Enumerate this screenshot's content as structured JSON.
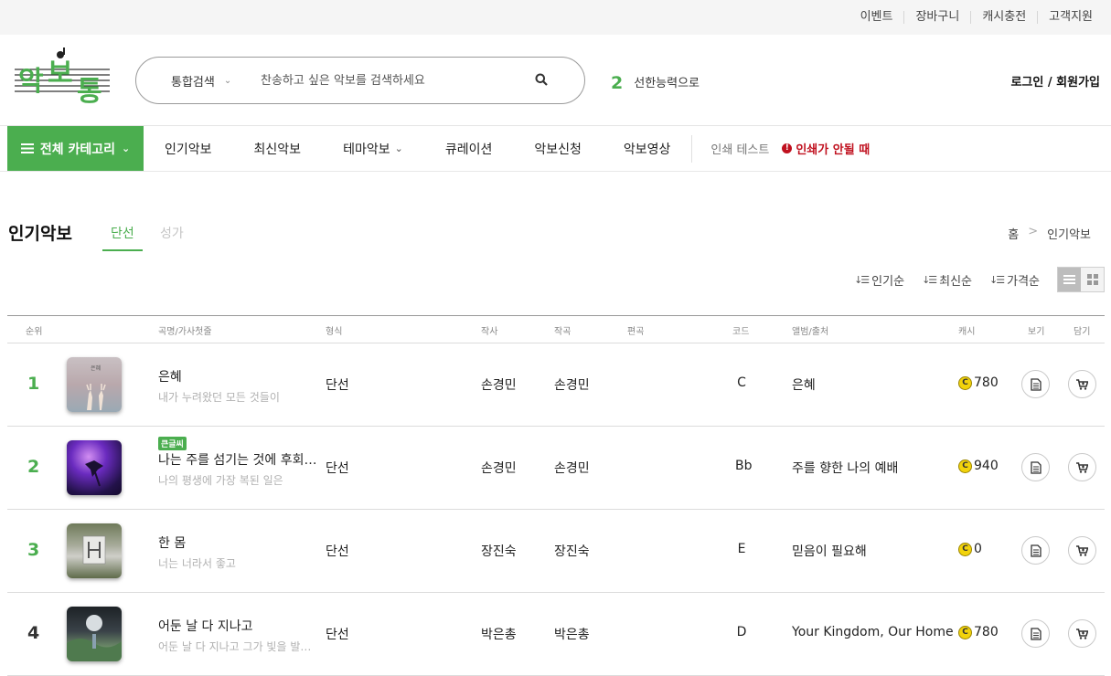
{
  "topbar": {
    "links": [
      "이벤트",
      "장바구니",
      "캐시충전",
      "고객지원"
    ]
  },
  "brand": {
    "logo_text": "악보통",
    "accent": "#4bae4f"
  },
  "search": {
    "scope": "통합검색",
    "placeholder": "찬송하고 싶은 악보를 검색하세요"
  },
  "trending": {
    "rank": "2",
    "term": "선한능력으로"
  },
  "account": {
    "login_label": "로그인 / 회원가입"
  },
  "nav": {
    "all_categories": "전체 카테고리",
    "items": [
      "인기악보",
      "최신악보",
      "테마악보",
      "큐레이션",
      "악보신청",
      "악보영상"
    ],
    "print_test": "인쇄 테스트",
    "print_warning": "인쇄가 안될 때"
  },
  "page": {
    "title": "인기악보",
    "tabs": [
      "단선",
      "성가"
    ],
    "breadcrumb": [
      "홈",
      "인기악보"
    ]
  },
  "sort": {
    "options": [
      "인기순",
      "최신순",
      "가격순"
    ]
  },
  "table": {
    "columns": [
      "순위",
      "곡명/가사첫줄",
      "형식",
      "작사",
      "작곡",
      "편곡",
      "코드",
      "앨범/출처",
      "캐시",
      "보기",
      "담기"
    ],
    "rows": [
      {
        "rank": "1",
        "title": "은혜",
        "lyric": "내가 누려왔던 모든 것들이",
        "badge": "",
        "format": "단선",
        "lyricist": "손경민",
        "composer": "손경민",
        "arranger": "",
        "key": "C",
        "album": "은혜",
        "cash": "780"
      },
      {
        "rank": "2",
        "title": "나는 주를 섬기는 것에 후회가 없습니다",
        "lyric": "나의 평생에 가장 복된 일은",
        "badge": "큰글씨",
        "format": "단선",
        "lyricist": "손경민",
        "composer": "손경민",
        "arranger": "",
        "key": "Bb",
        "album": "주를 향한 나의 예배",
        "cash": "940"
      },
      {
        "rank": "3",
        "title": "한 몸",
        "lyric": "너는 너라서 좋고",
        "badge": "",
        "format": "단선",
        "lyricist": "장진숙",
        "composer": "장진숙",
        "arranger": "",
        "key": "E",
        "album": "믿음이 필요해",
        "cash": "0"
      },
      {
        "rank": "4",
        "title": "어둔 날 다 지나고",
        "lyric": "어둔 날 다 지나고 그가 빛을 발하리",
        "badge": "",
        "format": "단선",
        "lyricist": "박은총",
        "composer": "박은총",
        "arranger": "",
        "key": "D",
        "album": "Your Kingdom, Our Home",
        "cash": "780"
      }
    ]
  },
  "icons": {
    "coin": "coin-icon",
    "view": "sheet-view-icon",
    "cart": "cart-icon"
  }
}
